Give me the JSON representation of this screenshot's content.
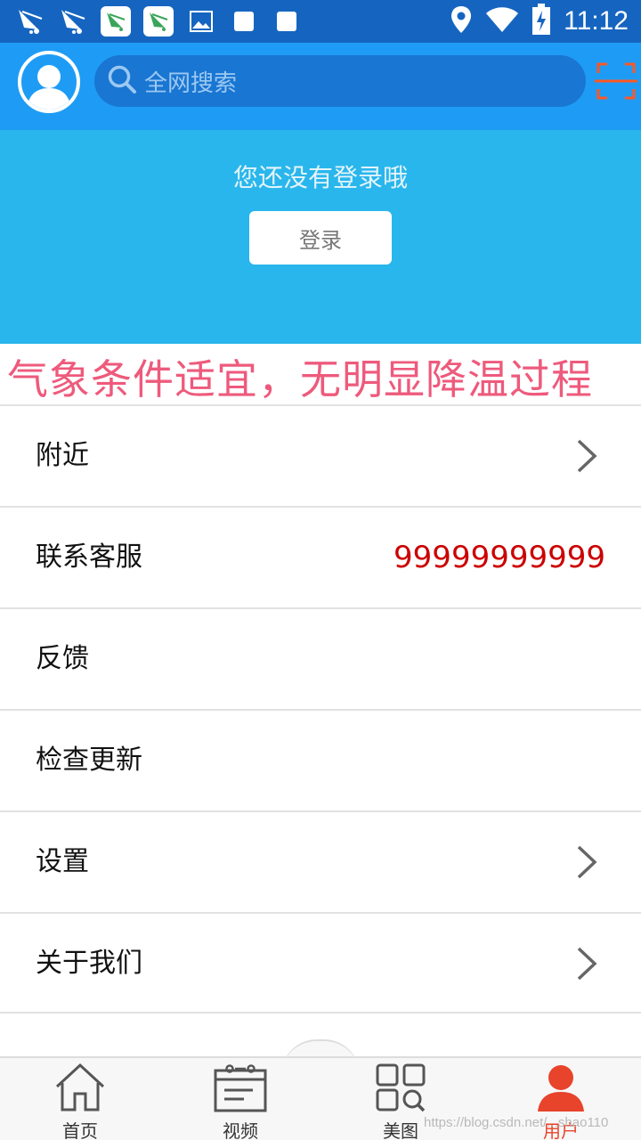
{
  "status_bar": {
    "time": "11:12",
    "left_icons": [
      "kite-icon",
      "kite-icon",
      "app-icon",
      "app-icon",
      "image-icon",
      "square-icon",
      "square-icon"
    ],
    "right_icons": [
      "location-icon",
      "wifi-icon",
      "battery-icon"
    ]
  },
  "header": {
    "search_placeholder": "全网搜索",
    "scan_icon": "scan-icon",
    "avatar_icon": "avatar-icon"
  },
  "banner": {
    "message": "您还没有登录哦",
    "login_label": "登录"
  },
  "marquee": {
    "text": "气象条件适宜，无明显降温过程"
  },
  "menu": {
    "items": [
      {
        "label": "附近",
        "chevron": true
      },
      {
        "label": "联系客服",
        "value": "99999999999"
      },
      {
        "label": "反馈"
      },
      {
        "label": "检查更新"
      },
      {
        "label": "设置",
        "chevron": true
      },
      {
        "label": "关于我们",
        "chevron": true
      }
    ]
  },
  "bottom_nav": {
    "items": [
      {
        "label": "首页",
        "icon": "home-icon"
      },
      {
        "label": "视频",
        "icon": "video-icon"
      },
      {
        "label": "美图",
        "icon": "gallery-icon"
      },
      {
        "label": "用户",
        "icon": "user-icon",
        "active": true
      }
    ]
  },
  "watermark": "https://blog.csdn.net/...shao110",
  "colors": {
    "status_bar": "#1565c0",
    "header": "#1e9cf5",
    "banner": "#29b6ec",
    "marquee_text": "#ee5a7c",
    "phone_value": "#cc0000",
    "nav_active": "#e8432b",
    "scan_accent": "#ff5722"
  }
}
